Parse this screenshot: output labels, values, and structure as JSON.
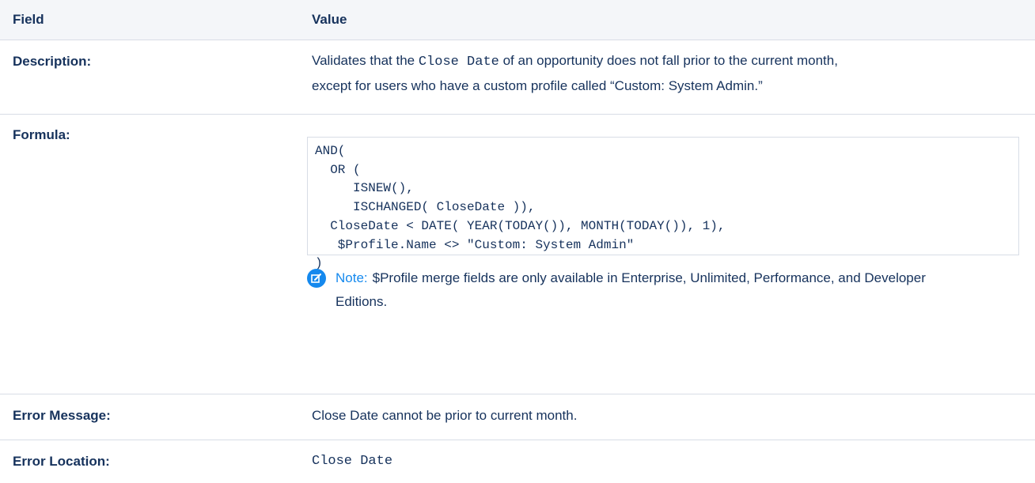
{
  "header": {
    "field": "Field",
    "value": "Value"
  },
  "description": {
    "label": "Description:",
    "text_before": "Validates that the ",
    "code": "Close Date",
    "text_after": " of an opportunity does not fall prior to the current month,",
    "line2": "except for users who have a custom profile called “Custom: System Admin.”"
  },
  "formula": {
    "label": "Formula:",
    "code": "AND(\n  OR (\n     ISNEW(),\n     ISCHANGED( CloseDate )),\n  CloseDate < DATE( YEAR(TODAY()), MONTH(TODAY()), 1),\n   $Profile.Name <> \"Custom: System Admin\"\n)"
  },
  "note": {
    "icon": "edit-icon",
    "label": "Note:",
    "text": "$Profile merge fields are only available in Enterprise, Unlimited, Performance, and Developer Editions."
  },
  "error_message": {
    "label": "Error Message:",
    "value": "Close Date cannot be prior to current month."
  },
  "error_location": {
    "label": "Error Location:",
    "value": "Close Date"
  }
}
